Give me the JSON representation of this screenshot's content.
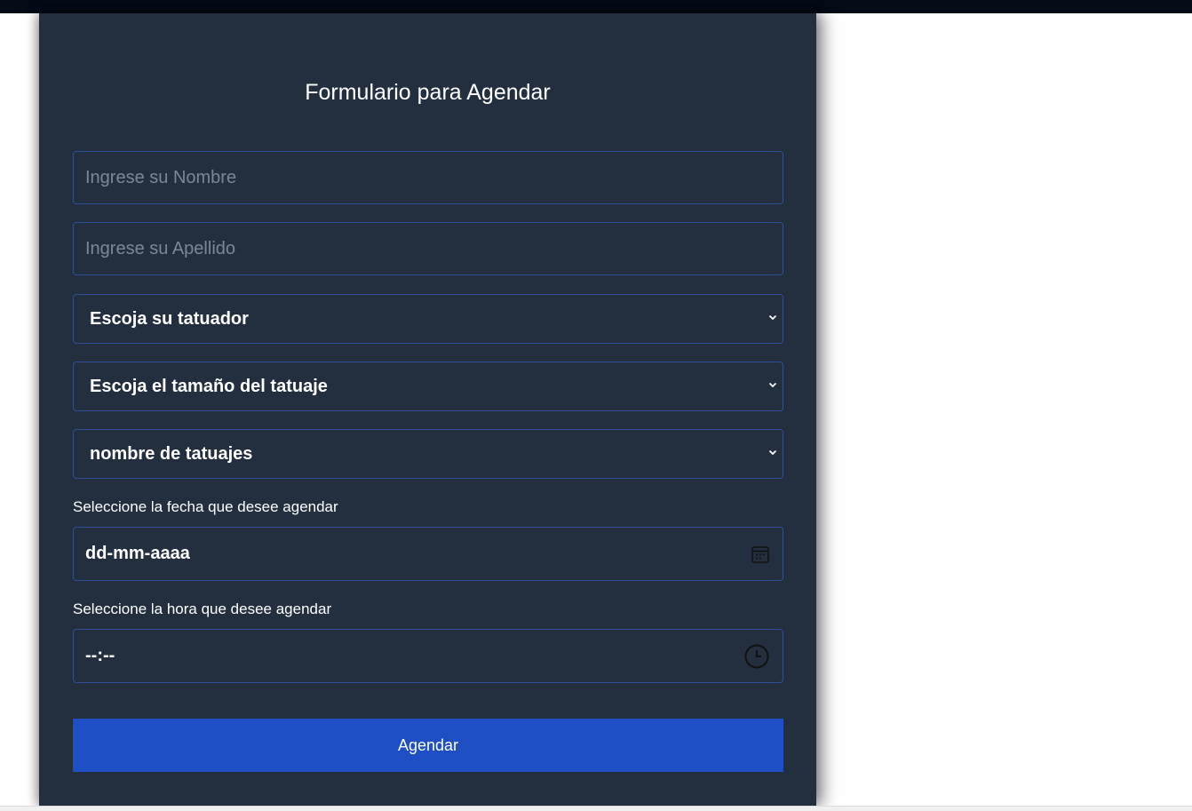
{
  "form": {
    "title": "Formulario para Agendar",
    "nombre_placeholder": "Ingrese su Nombre",
    "apellido_placeholder": "Ingrese su Apellido",
    "tatuador_select": "Escoja su tatuador",
    "tamano_select": "Escoja el tamaño del tatuaje",
    "tatuajes_select": "nombre de tatuajes",
    "fecha_label": "Seleccione la fecha que desee agendar",
    "fecha_value": "dd-mm-aaaa",
    "hora_label": "Seleccione la hora que desee agendar",
    "hora_value": "--:--",
    "submit_label": "Agendar"
  },
  "icons": {
    "select_arrow": "chevron-down-icon",
    "date_picker": "calendar-icon",
    "time_picker": "clock-icon"
  },
  "colors": {
    "card_background": "#232f3e",
    "field_border": "#2f4f9a",
    "button": "#1f4fc4",
    "top_bar": "#040a16"
  }
}
